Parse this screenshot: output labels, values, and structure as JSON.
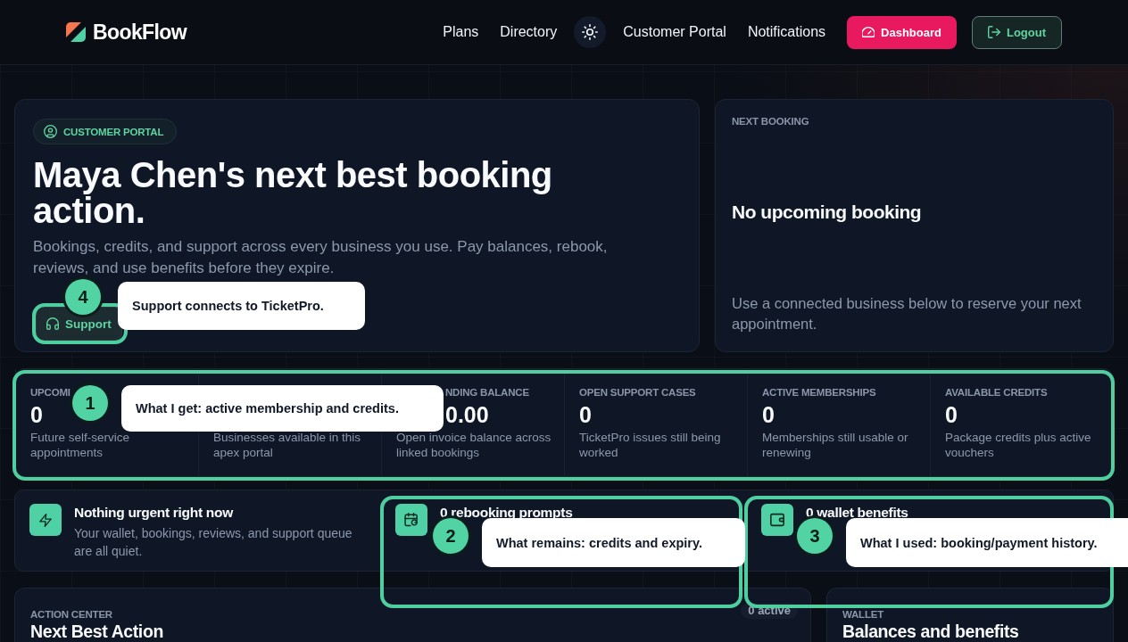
{
  "header": {
    "brand": "BookFlow",
    "nav": [
      {
        "kind": "link",
        "label": "Plans"
      },
      {
        "kind": "link",
        "label": "Directory"
      },
      {
        "kind": "theme_toggle"
      },
      {
        "kind": "link",
        "label": "Customer Portal"
      },
      {
        "kind": "link",
        "label": "Notifications"
      },
      {
        "kind": "primary_button",
        "label": "Dashboard"
      },
      {
        "kind": "outline_button",
        "label": "Logout"
      }
    ]
  },
  "hero": {
    "badge": "CUSTOMER PORTAL",
    "title": "Maya Chen's next best booking action.",
    "text": "Bookings, credits, and support across every business you use. Pay balances, rebook, reviews, and use benefits before they expire.",
    "button": "Support"
  },
  "next_booking": {
    "label": "NEXT BOOKING",
    "title": "No upcoming booking",
    "text": "Use a connected business below to reserve your next appointment."
  },
  "stats": [
    {
      "label": "UPCOMI",
      "value": "0",
      "text": "Future self-service appointments"
    },
    {
      "text": "Businesses available in this apex portal"
    },
    {
      "label": "NDING BALANCE",
      "value": "0.00",
      "text": "Open invoice balance across linked bookings"
    },
    {
      "label": "OPEN SUPPORT CASES",
      "value": "0",
      "text": "TicketPro issues still being worked"
    },
    {
      "label": "ACTIVE MEMBERSHIPS",
      "value": "0",
      "text": "Memberships still usable or renewing"
    },
    {
      "label": "AVAILABLE CREDITS",
      "value": "0",
      "text": "Package credits plus active vouchers"
    }
  ],
  "alerts": [
    {
      "kind": "status",
      "title": "Nothing urgent right now",
      "text": "Your wallet, bookings, reviews, and support queue are all quiet."
    },
    {
      "kind": "rebooking",
      "title": "0 rebooking prompts"
    },
    {
      "kind": "wallet",
      "title": "0 wallet benefits"
    }
  ],
  "sections": [
    {
      "label": "ACTION CENTER",
      "title": "Next Best Action",
      "badge": "0 active"
    },
    {
      "label": "WALLET",
      "title": "Balances and benefits"
    }
  ],
  "annotations": [
    {
      "number": "1",
      "text": "What I get: active membership and credits."
    },
    {
      "number": "2",
      "text": "What remains: credits and expiry."
    },
    {
      "number": "3",
      "text": "What I used: booking/payment history."
    },
    {
      "number": "4",
      "text": "Support connects to TicketPro."
    }
  ]
}
